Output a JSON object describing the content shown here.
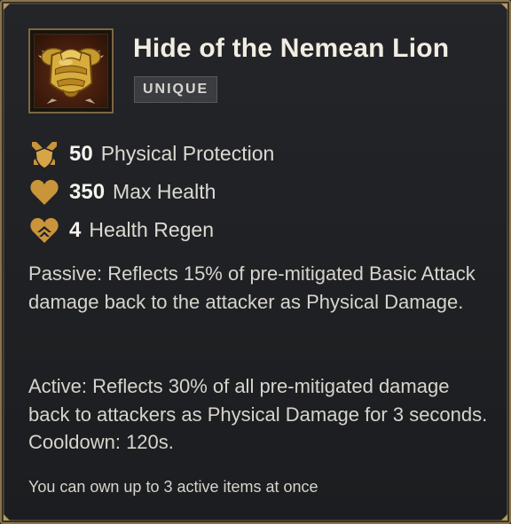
{
  "item": {
    "name": "Hide of the Nemean Lion",
    "rarity": "UNIQUE",
    "icon": "golden-armor-icon"
  },
  "stats": [
    {
      "icon": "crossed-swords-shield-icon",
      "value": "50",
      "label": "Physical Protection"
    },
    {
      "icon": "heart-icon",
      "value": "350",
      "label": "Max Health"
    },
    {
      "icon": "heart-regen-icon",
      "value": "4",
      "label": "Health Regen"
    }
  ],
  "description": {
    "passive": "Passive: Reflects 15% of pre-mitigated Basic Attack damage back to the attacker as Physical Damage.",
    "active": "Active: Reflects 30% of all pre-mitigated damage back to attackers as Physical Damage for 3 seconds. Cooldown: 120s."
  },
  "footer": {
    "note": "You can own up to 3 active items at once"
  },
  "colors": {
    "border_gold": "#8a7448",
    "background": "#1e2023",
    "icon_gold": "#c9943a",
    "text_primary": "#f2ede2",
    "text_body": "#d7d4cc"
  }
}
